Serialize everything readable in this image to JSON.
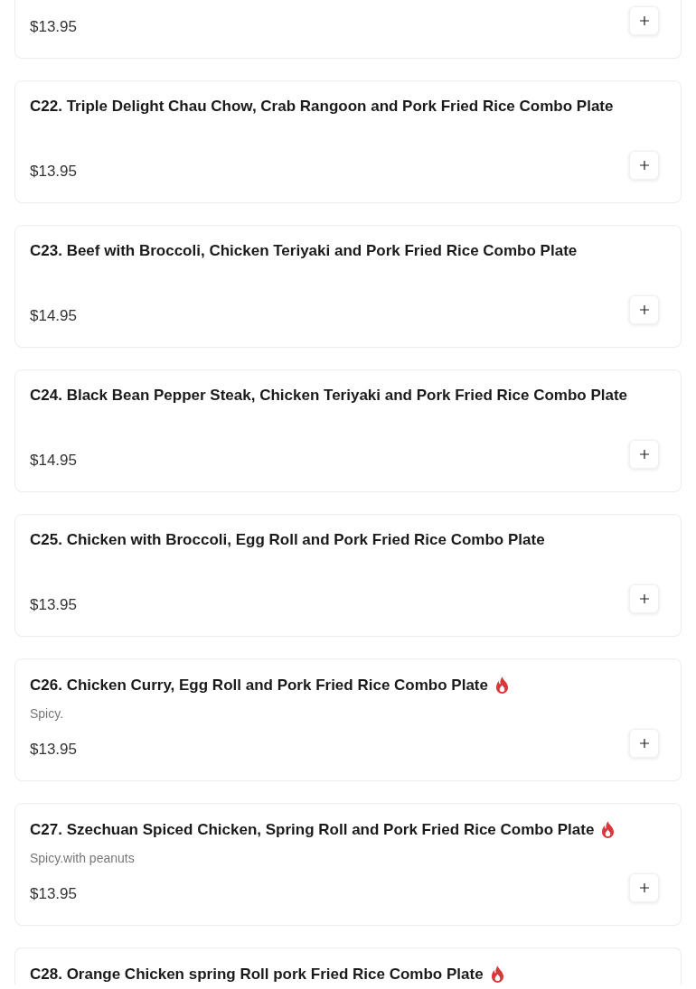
{
  "menu_items": [
    {
      "price": "$13.95"
    },
    {
      "title": "C22. Triple Delight Chau Chow, Crab Rangoon and Pork Fried Rice Combo Plate",
      "spicy": false,
      "price": "$13.95"
    },
    {
      "title": "C23. Beef with Broccoli, Chicken Teriyaki and Pork Fried Rice Combo Plate",
      "spicy": false,
      "price": "$14.95"
    },
    {
      "title": "C24. Black Bean Pepper Steak, Chicken Teriyaki and Pork Fried Rice Combo Plate",
      "spicy": false,
      "price": "$14.95"
    },
    {
      "title": "C25. Chicken with Broccoli, Egg Roll and Pork Fried Rice Combo Plate",
      "spicy": false,
      "price": "$13.95"
    },
    {
      "title": "C26. Chicken Curry, Egg Roll and Pork Fried Rice Combo Plate",
      "spicy": true,
      "description": "Spicy.",
      "price": "$13.95"
    },
    {
      "title": "C27. Szechuan Spiced Chicken, Spring Roll and Pork Fried Rice Combo Plate",
      "spicy": true,
      "description": "Spicy.with peanuts",
      "price": "$13.95"
    },
    {
      "title": "C28. Orange Chicken spring Roll pork Fried Rice Combo Plate",
      "spicy": true
    }
  ]
}
